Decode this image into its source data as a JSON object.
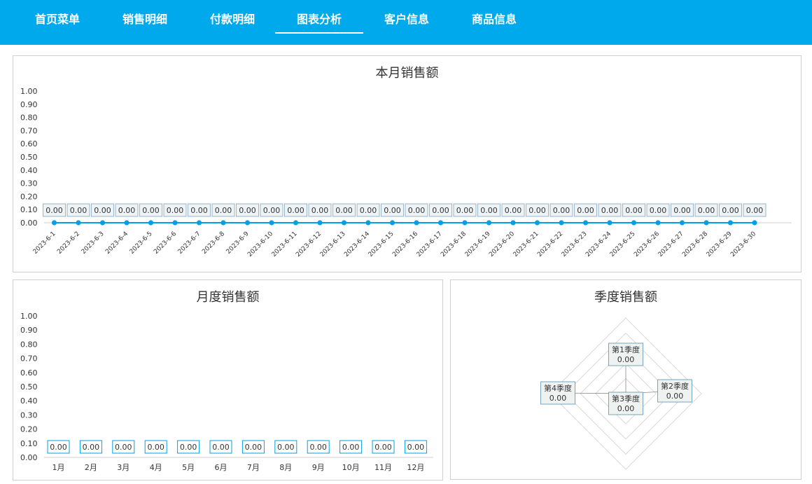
{
  "nav": {
    "items": [
      {
        "label": "首页菜单",
        "active": false
      },
      {
        "label": "销售明细",
        "active": false
      },
      {
        "label": "付款明细",
        "active": false
      },
      {
        "label": "图表分析",
        "active": true
      },
      {
        "label": "客户信息",
        "active": false
      },
      {
        "label": "商品信息",
        "active": false
      }
    ]
  },
  "colors": {
    "accent": "#00a9ec",
    "series": "#00a0e9"
  },
  "chart_data": [
    {
      "type": "line",
      "title": "本月销售额",
      "yticks": [
        "1.00",
        "0.90",
        "0.80",
        "0.70",
        "0.60",
        "0.50",
        "0.40",
        "0.30",
        "0.20",
        "0.10",
        "0.00"
      ],
      "ylim": [
        0,
        1
      ],
      "x": [
        "2023-6-1",
        "2023-6-2",
        "2023-6-3",
        "2023-6-4",
        "2023-6-5",
        "2023-6-6",
        "2023-6-7",
        "2023-6-8",
        "2023-6-9",
        "2023-6-10",
        "2023-6-11",
        "2023-6-12",
        "2023-6-13",
        "2023-6-14",
        "2023-6-15",
        "2023-6-16",
        "2023-6-17",
        "2023-6-18",
        "2023-6-19",
        "2023-6-20",
        "2023-6-21",
        "2023-6-22",
        "2023-6-23",
        "2023-6-24",
        "2023-6-25",
        "2023-6-26",
        "2023-6-27",
        "2023-6-28",
        "2023-6-29",
        "2023-6-30"
      ],
      "values": [
        0,
        0,
        0,
        0,
        0,
        0,
        0,
        0,
        0,
        0,
        0,
        0,
        0,
        0,
        0,
        0,
        0,
        0,
        0,
        0,
        0,
        0,
        0,
        0,
        0,
        0,
        0,
        0,
        0,
        0
      ],
      "value_labels": "0.00"
    },
    {
      "type": "bar",
      "title": "月度销售额",
      "yticks": [
        "1.00",
        "0.90",
        "0.80",
        "0.70",
        "0.60",
        "0.50",
        "0.40",
        "0.30",
        "0.20",
        "0.10",
        "0.00"
      ],
      "ylim": [
        0,
        1
      ],
      "categories": [
        "1月",
        "2月",
        "3月",
        "4月",
        "5月",
        "6月",
        "7月",
        "8月",
        "9月",
        "10月",
        "11月",
        "12月"
      ],
      "values": [
        0,
        0,
        0,
        0,
        0,
        0,
        0,
        0,
        0,
        0,
        0,
        0
      ],
      "value_labels": "0.00"
    },
    {
      "type": "radar",
      "title": "季度销售额",
      "categories": [
        "第1季度",
        "第2季度",
        "第3季度",
        "第4季度"
      ],
      "values": [
        0,
        0,
        0,
        0
      ],
      "value_labels": "0.00"
    }
  ]
}
